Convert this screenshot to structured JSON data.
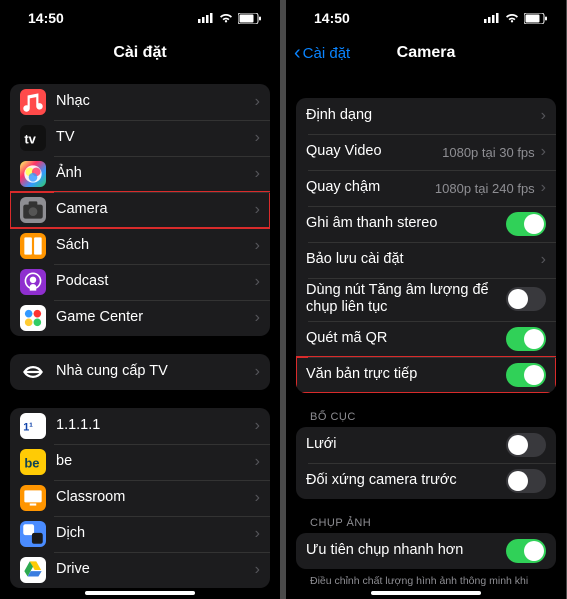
{
  "status": {
    "time": "14:50"
  },
  "left": {
    "title": "Cài đặt",
    "group1": [
      {
        "icon": "music",
        "bg": "#ff4a4a",
        "label": "Nhạc"
      },
      {
        "icon": "tv",
        "bg": "#111",
        "label": "TV"
      },
      {
        "icon": "photos",
        "bg": "linear-gradient(135deg,#ff6,#f36,#39f,#3c6)",
        "label": "Ảnh"
      },
      {
        "icon": "camera",
        "bg": "#8e8e93",
        "label": "Camera",
        "hl": true
      },
      {
        "icon": "books",
        "bg": "#ff9500",
        "label": "Sách"
      },
      {
        "icon": "podcast",
        "bg": "#8f2fcf",
        "label": "Podcast"
      },
      {
        "icon": "game",
        "bg": "#fff",
        "label": "Game Center"
      }
    ],
    "group2": [
      {
        "icon": "tvprov",
        "bg": "#1c1c1e",
        "label": "Nhà cung cấp TV"
      }
    ],
    "group3": [
      {
        "icon": "1111",
        "bg": "#fff",
        "label": "1.1.1.1"
      },
      {
        "icon": "be",
        "bg": "#ffcb05",
        "label": "be"
      },
      {
        "icon": "class",
        "bg": "#ff9500",
        "label": "Classroom"
      },
      {
        "icon": "dich",
        "bg": "#4a8cff",
        "label": "Dịch"
      },
      {
        "icon": "drive",
        "bg": "#fff",
        "label": "Drive"
      }
    ]
  },
  "right": {
    "back": "Cài đặt",
    "title": "Camera",
    "group1": [
      {
        "label": "Định dạng",
        "type": "nav"
      },
      {
        "label": "Quay Video",
        "type": "nav",
        "detail": "1080p tại 30 fps"
      },
      {
        "label": "Quay chậm",
        "type": "nav",
        "detail": "1080p tại 240 fps"
      },
      {
        "label": "Ghi âm thanh stereo",
        "type": "toggle",
        "on": true
      },
      {
        "label": "Bảo lưu cài đặt",
        "type": "nav"
      },
      {
        "label": "Dùng nút Tăng âm lượng để chụp liên tục",
        "type": "toggle",
        "on": false
      },
      {
        "label": "Quét mã QR",
        "type": "toggle",
        "on": true
      },
      {
        "label": "Văn bản trực tiếp",
        "type": "toggle",
        "on": true,
        "hl": true
      }
    ],
    "section2_header": "BỐ CỤC",
    "group2": [
      {
        "label": "Lưới",
        "type": "toggle",
        "on": false
      },
      {
        "label": "Đối xứng camera trước",
        "type": "toggle",
        "on": false
      }
    ],
    "section3_header": "CHỤP ẢNH",
    "group3": [
      {
        "label": "Ưu tiên chụp nhanh hơn",
        "type": "toggle",
        "on": true
      }
    ],
    "footnote": "Điều chỉnh chất lượng hình ảnh thông minh khi"
  }
}
